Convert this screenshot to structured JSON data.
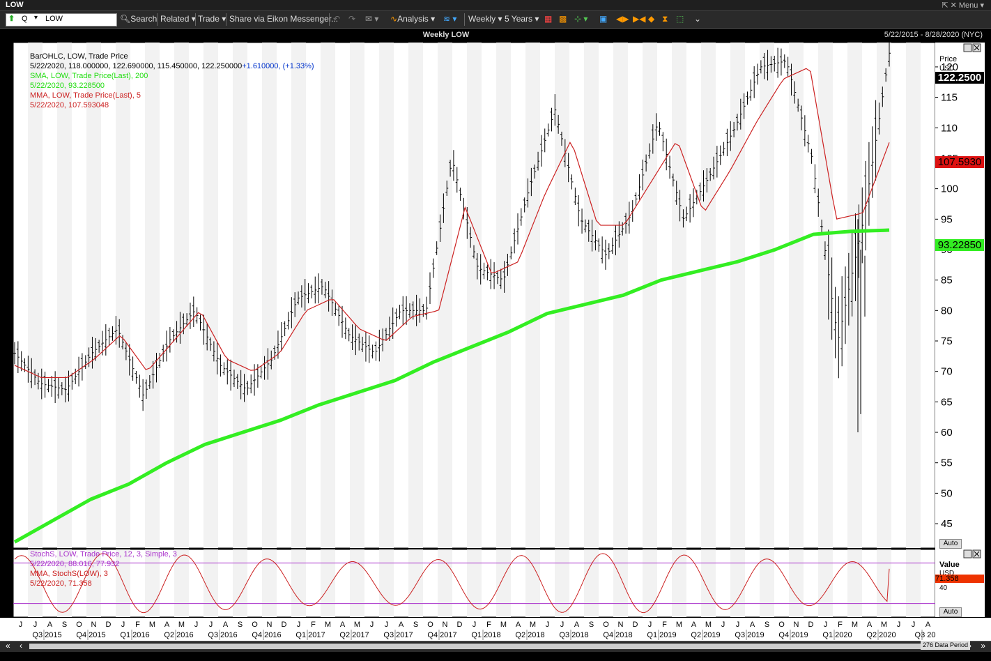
{
  "window": {
    "title": "LOW",
    "menu": "Menu"
  },
  "toolbar": {
    "ticker_mode": "Q",
    "ticker_value": "LOW",
    "search": "Search",
    "related": "Related",
    "trade": "Trade",
    "share": "Share via Eikon Messenger...",
    "analysis": "Analysis",
    "interval": "Weekly",
    "range": "5 Years"
  },
  "chart": {
    "title": "Weekly LOW",
    "date_range": "5/22/2015 - 8/28/2020 (NYC)",
    "price_axis_title": "Price",
    "price_axis_unit": "USD",
    "value_axis_title": "Value",
    "value_axis_unit": "USD",
    "auto_label": "Auto",
    "data_period": "276 Data Period",
    "legend": {
      "line1": "BarOHLC, LOW, Trade Price",
      "line2_values": "5/22/2020, 118.000000, 122.690000, 115.450000, 122.250000",
      "line2_change": "+1.610000, (+1.33%)",
      "line3": "SMA, LOW, Trade Price(Last),  200",
      "line4": "5/22/2020, 93.228500",
      "line5": "MMA, LOW, Trade Price(Last),  5",
      "line6": "5/22/2020, 107.593048"
    },
    "stoch_legend": {
      "line1": "StochS, LOW, Trade Price,  12, 3, Simple, 3",
      "line2": "5/22/2020, 88.016, 77.932",
      "line3": "MMA, StochS(LOW),  3",
      "line4": "5/22/2020, 71.358"
    },
    "price_badges": {
      "last": "122.2500",
      "mma": "107.5930",
      "sma": "93.22850"
    },
    "value_badges": {
      "mma": "71.358",
      "tick": "40"
    },
    "months": [
      "J",
      "J",
      "A",
      "S",
      "O",
      "N",
      "D",
      "J",
      "F",
      "M",
      "A",
      "M",
      "J",
      "J",
      "A",
      "S",
      "O",
      "N",
      "D",
      "J",
      "F",
      "M",
      "A",
      "M",
      "J",
      "J",
      "A",
      "S",
      "O",
      "N",
      "D",
      "J",
      "F",
      "M",
      "A",
      "M",
      "J",
      "J",
      "A",
      "S",
      "O",
      "N",
      "D",
      "J",
      "F",
      "M",
      "A",
      "M",
      "J",
      "J",
      "A",
      "S",
      "O",
      "N",
      "D",
      "J",
      "F",
      "M",
      "A",
      "M",
      "J",
      "J",
      "A"
    ],
    "quarters": [
      "Q3 2015",
      "Q4 2015",
      "Q1 2016",
      "Q2 2016",
      "Q3 2016",
      "Q4 2016",
      "Q1 2017",
      "Q2 2017",
      "Q3 2017",
      "Q4 2017",
      "Q1 2018",
      "Q2 2018",
      "Q3 2018",
      "Q4 2018",
      "Q1 2019",
      "Q2 2019",
      "Q3 2019",
      "Q4 2019",
      "Q1 2020",
      "Q2 2020",
      "Q3 20"
    ],
    "colors": {
      "ohlc": "#000000",
      "sma": "#33ee22",
      "mma": "#cc2222",
      "stoch_line": "#aa33cc",
      "stoch_mma": "#cc2222"
    }
  },
  "chart_data": {
    "type": "line",
    "ylim": [
      41,
      124
    ],
    "yticks": [
      45,
      50,
      55,
      60,
      65,
      70,
      75,
      80,
      85,
      90,
      95,
      100,
      105,
      110,
      115,
      120
    ],
    "x_dates": [
      "2015-05",
      "2015-07",
      "2015-09",
      "2015-11",
      "2016-01",
      "2016-03",
      "2016-05",
      "2016-07",
      "2016-09",
      "2016-11",
      "2017-01",
      "2017-03",
      "2017-05",
      "2017-07",
      "2017-09",
      "2017-11",
      "2018-01",
      "2018-03",
      "2018-05",
      "2018-07",
      "2018-09",
      "2018-11",
      "2019-01",
      "2019-03",
      "2019-05",
      "2019-07",
      "2019-09",
      "2019-11",
      "2020-01",
      "2020-02",
      "2020-03",
      "2020-04",
      "2020-05"
    ],
    "series": [
      {
        "name": "LOW Close",
        "values": [
          73,
          68,
          67,
          73,
          77,
          66,
          75,
          80,
          71,
          67,
          72,
          82,
          84,
          76,
          73,
          80,
          80,
          105,
          87,
          85,
          100,
          113,
          95,
          89,
          96,
          111,
          95,
          102,
          110,
          120,
          121,
          105,
          75,
          95,
          122.25
        ]
      },
      {
        "name": "SMA 200",
        "values": [
          42,
          45.5,
          49,
          51.5,
          55,
          58,
          60,
          62,
          64.5,
          66.5,
          68.5,
          71.5,
          74,
          76.5,
          79.5,
          81,
          82.5,
          85,
          86.5,
          88,
          90,
          92.5,
          93,
          93.2
        ]
      },
      {
        "name": "MMA 5",
        "values": [
          71,
          69,
          69,
          72,
          76,
          70,
          75,
          80,
          72,
          70,
          73,
          80,
          82,
          77,
          75,
          79,
          80,
          97,
          86,
          88,
          99,
          108,
          94,
          94,
          101,
          108,
          96,
          103,
          111,
          118,
          120,
          95,
          96,
          107.59
        ]
      }
    ],
    "stoch": {
      "ylim": [
        0,
        100
      ],
      "upper_band": 80,
      "lower_band": 20,
      "last": 88.016,
      "signal": 77.932,
      "mma": 71.358
    }
  }
}
